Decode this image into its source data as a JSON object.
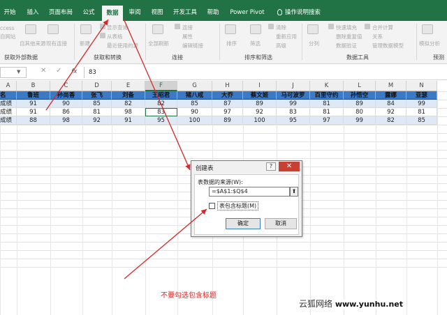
{
  "tabs": [
    {
      "label": "开始",
      "active": false
    },
    {
      "label": "插入",
      "active": false
    },
    {
      "label": "页面布局",
      "active": false
    },
    {
      "label": "公式",
      "active": false
    },
    {
      "label": "数据",
      "active": true
    },
    {
      "label": "审阅",
      "active": false
    },
    {
      "label": "视图",
      "active": false
    },
    {
      "label": "开发工具",
      "active": false
    },
    {
      "label": "帮助",
      "active": false
    },
    {
      "label": "Power Pivot",
      "active": false
    },
    {
      "label": "操作说明搜索",
      "active": false
    }
  ],
  "ribbon": {
    "items": [
      "ccess",
      "自网站",
      "自其他来源",
      "现有连接",
      "新建",
      "显示查询",
      "从表格",
      "最近使用的源",
      "全部刷新",
      "连接",
      "属性",
      "编辑链接",
      "排序",
      "筛选",
      "清除",
      "重新应用",
      "高级",
      "分列",
      "快速填充",
      "删除重复值",
      "数据验证",
      "合并计算",
      "关系",
      "管理数据模型",
      "模拟分析",
      "预测"
    ],
    "groups": [
      "获取外部数据",
      "获取和转换",
      "连接",
      "排序和筛选",
      "数据工具",
      "预测"
    ]
  },
  "formula_bar": {
    "cancel": "✕",
    "confirm": "✓",
    "fx": "fx",
    "value": "83"
  },
  "columns": [
    "A",
    "B",
    "C",
    "D",
    "E",
    "F",
    "G",
    "H",
    "I",
    "J",
    "K",
    "L",
    "M",
    "N"
  ],
  "table": {
    "header": [
      "名",
      "鲁班",
      "孙尚香",
      "张飞",
      "刘备",
      "王昭君",
      "猪八戒",
      "大乔",
      "蔡文姬",
      "马可波罗",
      "百里守约",
      "孙悟空",
      "露娜",
      "亚瑟"
    ],
    "rows": [
      [
        "成绩",
        "91",
        "90",
        "85",
        "82",
        "82",
        "85",
        "87",
        "89",
        "99",
        "81",
        "89",
        "84",
        "99"
      ],
      [
        "成绩",
        "91",
        "86",
        "81",
        "98",
        "83",
        "90",
        "97",
        "92",
        "83",
        "81",
        "80",
        "92",
        "81"
      ],
      [
        "成绩",
        "88",
        "98",
        "92",
        "91",
        "95",
        "100",
        "89",
        "100",
        "95",
        "97",
        "99",
        "82",
        "85"
      ]
    ]
  },
  "dialog": {
    "title": "创建表",
    "help": "?",
    "close": "✕",
    "label": "表数据的来源(W):",
    "range": "=$A$1:$Q$4",
    "checkbox_label": "表包含标题(M)",
    "checked": false,
    "ok": "确定",
    "cancel": "取消"
  },
  "annotation": "不要勾选包含标题",
  "watermark": {
    "text": "云狐网络",
    "url": "www.yunhu.net"
  },
  "colors": {
    "brand": "#217346",
    "table_header": "#3d7ac6",
    "table_band": "#dfe9f6",
    "annotation": "#d62828"
  }
}
